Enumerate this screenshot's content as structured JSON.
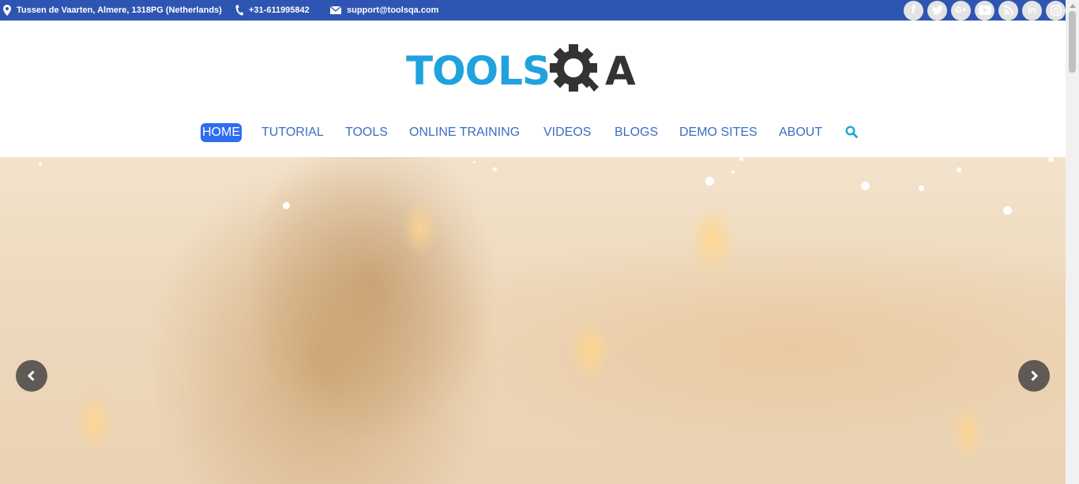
{
  "contact": {
    "address": "Tussen de Vaarten, Almere, 1318PG (Netherlands)",
    "phone": "+31-611995842",
    "email": "support@toolsqa.com"
  },
  "social": [
    {
      "name": "facebook-icon",
      "glyph": "f"
    },
    {
      "name": "twitter-icon",
      "glyph": ""
    },
    {
      "name": "google-plus-icon",
      "glyph": "G+"
    },
    {
      "name": "youtube-icon",
      "glyph": ""
    },
    {
      "name": "rss-icon",
      "glyph": ""
    },
    {
      "name": "linkedin-icon",
      "glyph": "in"
    },
    {
      "name": "instagram-icon",
      "glyph": ""
    }
  ],
  "logo": {
    "part1": "TOOLS",
    "part2": "A"
  },
  "nav": {
    "home": "HOME",
    "tutorial": "TUTORIAL",
    "tools": "TOOLS",
    "online_training": "ONLINE TRAINING",
    "videos": "VIDEOS",
    "blogs": "BLOGS",
    "demo_sites": "DEMO SITES",
    "about": "ABOUT",
    "active": "HOME"
  },
  "colors": {
    "topbar": "#2f55b2",
    "logo_blue": "#1fa2de",
    "logo_dark": "#333333",
    "nav_link": "#3b6ec4",
    "nav_active_bg": "#2d6df0",
    "search_icon": "#1fa2de",
    "carousel_arrow_bg": "#5f5a55"
  },
  "carousel": {
    "prev_icon": "chevron-left-icon",
    "next_icon": "chevron-right-icon"
  }
}
